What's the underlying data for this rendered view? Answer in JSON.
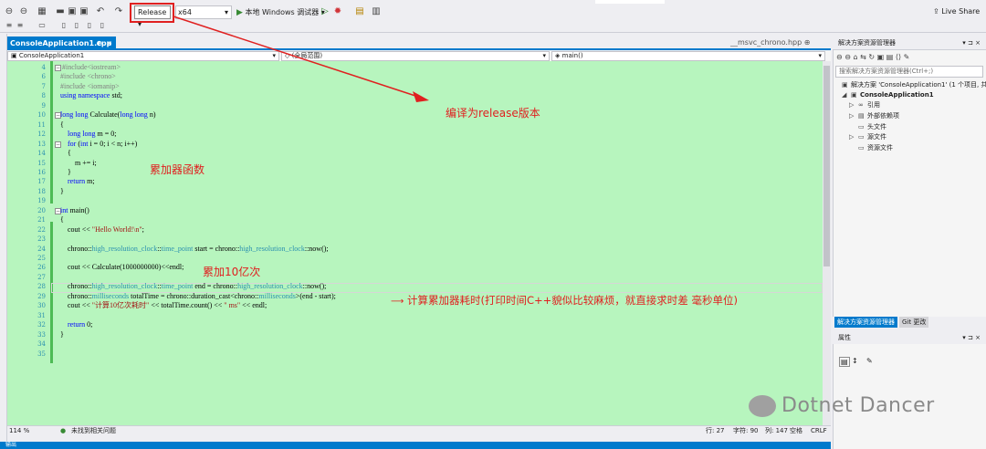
{
  "toolbar": {
    "configuration": "Release",
    "platform": "x64",
    "run_label": "本地 Windows 调试器",
    "live_share": "Live Share"
  },
  "tabs": {
    "active": "ConsoleApplication1.cpp",
    "pin": "⊕",
    "close": "×",
    "other": "__msvc_chrono.hpp"
  },
  "nav": {
    "project": "ConsoleApplication1",
    "scope": "(全局范围)",
    "member": "main()"
  },
  "editor": {
    "lines": [
      {
        "n": "4",
        "t": "#include<iostream>"
      },
      {
        "n": "6",
        "t": "#include <chrono>"
      },
      {
        "n": "7",
        "t": "#include <iomanip>"
      },
      {
        "n": "8",
        "t": "using namespace std;"
      },
      {
        "n": "9",
        "t": ""
      },
      {
        "n": "10",
        "t": "long long Calculate(long long n)"
      },
      {
        "n": "11",
        "t": "{"
      },
      {
        "n": "12",
        "t": "    long long m = 0;"
      },
      {
        "n": "13",
        "t": "    for (int i = 0; i < n; i++)"
      },
      {
        "n": "14",
        "t": "    {"
      },
      {
        "n": "15",
        "t": "        m += i;"
      },
      {
        "n": "16",
        "t": "    }"
      },
      {
        "n": "17",
        "t": "    return m;"
      },
      {
        "n": "18",
        "t": "}"
      },
      {
        "n": "19",
        "t": ""
      },
      {
        "n": "20",
        "t": "int main()"
      },
      {
        "n": "21",
        "t": "{"
      },
      {
        "n": "22",
        "t": "    cout << \"Hello World!\\n\";"
      },
      {
        "n": "23",
        "t": ""
      },
      {
        "n": "24",
        "t": "    chrono::high_resolution_clock::time_point start = chrono::high_resolution_clock::now();"
      },
      {
        "n": "25",
        "t": ""
      },
      {
        "n": "26",
        "t": "    cout << Calculate(1000000000)<<endl;"
      },
      {
        "n": "27",
        "t": ""
      },
      {
        "n": "28",
        "t": "    chrono::high_resolution_clock::time_point end = chrono::high_resolution_clock::now();"
      },
      {
        "n": "29",
        "t": "    chrono::milliseconds totalTime = chrono::duration_cast<chrono::milliseconds>(end - start);"
      },
      {
        "n": "30",
        "t": "    cout << \"计算10亿次耗时\" << totalTime.count() << \" ms\" << endl;"
      },
      {
        "n": "31",
        "t": ""
      },
      {
        "n": "32",
        "t": "    return 0;"
      },
      {
        "n": "33",
        "t": "}"
      },
      {
        "n": "34",
        "t": ""
      },
      {
        "n": "35",
        "t": ""
      }
    ]
  },
  "annotations": {
    "release": "编译为release版本",
    "accumulator": "累加器函数",
    "billion": "累加10亿次",
    "timing": "计算累加器耗时(打印时间C++貌似比较麻烦，就直接求时差 毫秒单位)"
  },
  "status": {
    "zoom": "114 %",
    "issues": "未找到相关问题",
    "line": "行: 27",
    "char": "字符: 90",
    "col": "列: 147",
    "ws": "空格",
    "eol": "CRLF"
  },
  "solution_explorer": {
    "title": "解决方案资源管理器",
    "search_placeholder": "搜索解决方案资源管理器(Ctrl+;)",
    "solution": "解决方案 'ConsoleApplication1' (1 个项目, 共",
    "project": "ConsoleApplication1",
    "items": [
      "引用",
      "外部依赖项",
      "头文件",
      "源文件",
      "资源文件"
    ],
    "tab_1": "解决方案资源管理器",
    "tab_2": "Git 更改"
  },
  "properties": {
    "title": "属性"
  },
  "bottom_panel": {
    "label": "输出"
  },
  "watermark": {
    "text": "Dotnet Dancer"
  }
}
